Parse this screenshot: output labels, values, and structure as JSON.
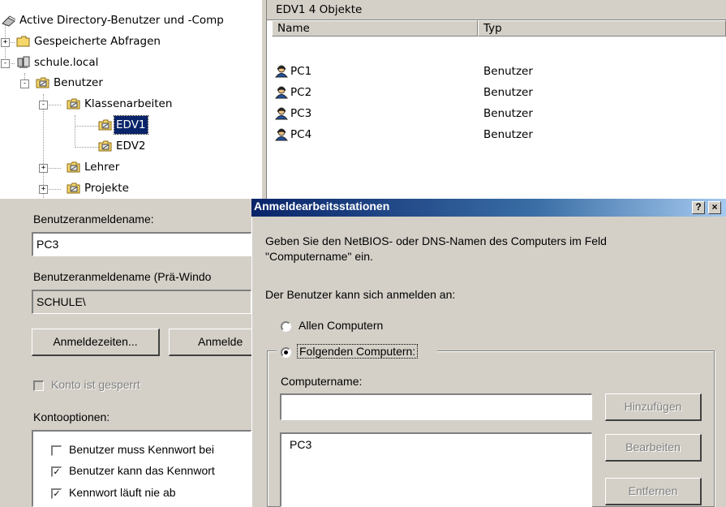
{
  "tree": {
    "root": "Active Directory-Benutzer und -Comp",
    "items": [
      {
        "label": "Gespeicherte Abfragen",
        "icon": "folder-icon"
      },
      {
        "label": "schule.local",
        "icon": "domain-icon"
      },
      {
        "label": "Benutzer",
        "icon": "ou-icon"
      },
      {
        "label": "Klassenarbeiten",
        "icon": "ou-icon"
      },
      {
        "label": "EDV1",
        "icon": "ou-icon",
        "selected": true
      },
      {
        "label": "EDV2",
        "icon": "ou-icon"
      },
      {
        "label": "Lehrer",
        "icon": "ou-icon"
      },
      {
        "label": "Projekte",
        "icon": "ou-icon"
      }
    ]
  },
  "list": {
    "header": "EDV1   4 Objekte",
    "columns": [
      "Name",
      "Typ"
    ],
    "rows": [
      {
        "name": "PC1",
        "type": "Benutzer"
      },
      {
        "name": "PC2",
        "type": "Benutzer"
      },
      {
        "name": "PC3",
        "type": "Benutzer"
      },
      {
        "name": "PC4",
        "type": "Benutzer"
      }
    ]
  },
  "props": {
    "logon_label": "Benutzeranmeldename:",
    "logon_value": "PC3",
    "pre2000_label": "Benutzeranmeldename (Prä-Windo",
    "pre2000_value": "SCHULE\\",
    "btn_logon_hours": "Anmeldezeiten...",
    "btn_logon_to": "Anmelde",
    "locked_label": "Konto ist gesperrt",
    "options_label": "Kontooptionen:",
    "options": [
      {
        "label": "Benutzer muss Kennwort bei",
        "checked": false
      },
      {
        "label": "Benutzer kann das Kennwort",
        "checked": true
      },
      {
        "label": "Kennwort läuft nie ab",
        "checked": true
      }
    ]
  },
  "workstations": {
    "title": "Anmeldearbeitsstationen",
    "help_btn": "?",
    "close_btn": "×",
    "desc_line1": "Geben Sie den NetBIOS- oder DNS-Namen des Computers im Feld",
    "desc_line2": "\"Computername\" ein.",
    "logon_to_label": "Der Benutzer kann sich anmelden an:",
    "radio_all": "Allen Computern",
    "radio_following": "Folgenden Computern:",
    "computername_label": "Computername:",
    "computername_value": "",
    "list_items": [
      "PC3"
    ],
    "btn_add": "Hinzufügen",
    "btn_edit": "Bearbeiten",
    "btn_remove": "Entfernen"
  },
  "colors": {
    "selection": "#0a246a",
    "dialog_bg": "#d4d0c8"
  }
}
